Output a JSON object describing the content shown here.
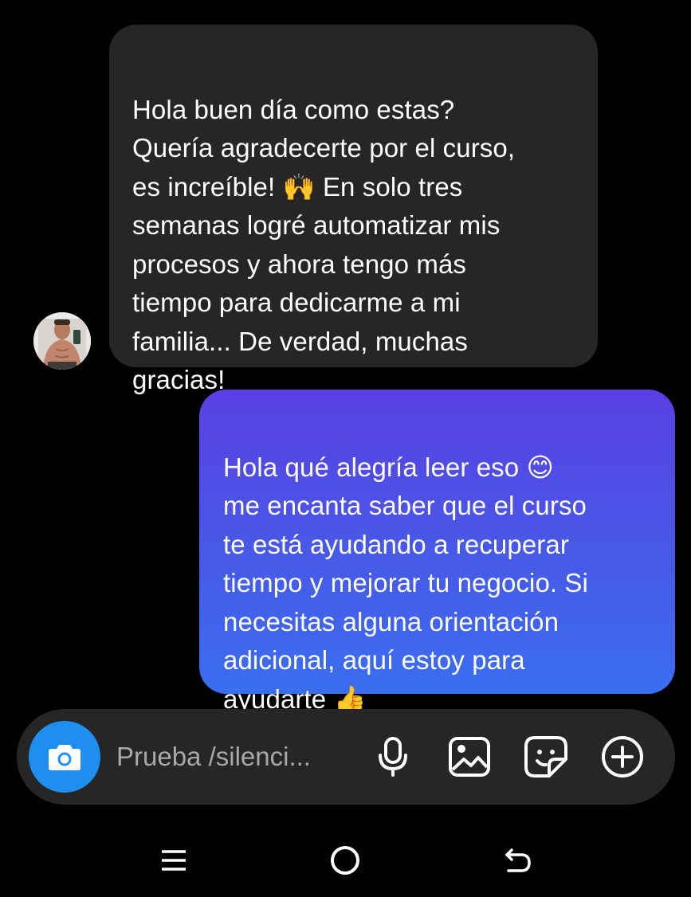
{
  "conversation": {
    "incoming_message": "Hola buen día como estas?\nQuería agradecerte por el curso,\nes increíble! 🙌 En solo tres\nsemanas logré automatizar mis\nprocesos y ahora tengo más\ntiempo para dedicarme a mi\nfamilia... De verdad, muchas\ngracias!",
    "outgoing_message": "Hola qué alegría leer eso 😊\nme encanta saber que el curso\nte está ayudando a recuperar\ntiempo y mejorar tu negocio. Si\nnecesitas alguna orientación\nadicional, aquí estoy para\nayudarte 👍"
  },
  "composer": {
    "placeholder": "Prueba /silenci...",
    "icons": [
      "camera-icon",
      "microphone-icon",
      "gallery-icon",
      "sticker-icon",
      "plus-circle-icon"
    ]
  },
  "navigation": {
    "icons": [
      "recent-apps-icon",
      "home-icon",
      "back-icon"
    ]
  },
  "colors": {
    "background": "#000000",
    "incoming_bubble": "#262626",
    "outgoing_gradient_top": "#5a3fe4",
    "outgoing_gradient_bottom": "#3a6ef0",
    "camera_button": "#1e8ff0",
    "placeholder_text": "#a8a8a8"
  }
}
